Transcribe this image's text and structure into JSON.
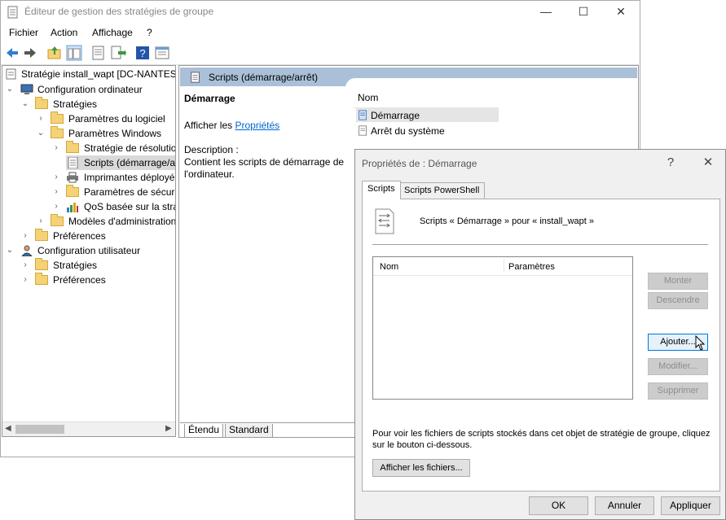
{
  "window": {
    "title": "Éditeur de gestion des stratégies de groupe",
    "minimize": "—",
    "maximize": "☐",
    "close": "✕"
  },
  "menu": {
    "file": "Fichier",
    "action": "Action",
    "view": "Affichage",
    "help": "?"
  },
  "tree": {
    "root": "Stratégie install_wapt [DC-NANTES.",
    "computer_config": "Configuration ordinateur",
    "strategies": "Stratégies",
    "software_settings": "Paramètres du logiciel",
    "windows_settings": "Paramètres Windows",
    "name_resolution": "Stratégie de résolutio",
    "scripts": "Scripts (démarrage/ar",
    "printers": "Imprimantes déployé",
    "security": "Paramètres de sécurit",
    "qos": "QoS basée sur la strat",
    "admin_templates": "Modèles d'administration",
    "preferences": "Préférences",
    "user_config": "Configuration utilisateur",
    "user_strategies": "Stratégies",
    "user_preferences": "Préférences"
  },
  "pane": {
    "header": "Scripts (démarrage/arrêt)",
    "selected_title": "Démarrage",
    "show_prefix": "Afficher les ",
    "show_link": "Propriétés",
    "description_label": "Description :",
    "description_text_1": "Contient les scripts de démarrage de",
    "description_text_2": "l'ordinateur.",
    "col_name": "Nom",
    "items": [
      "Démarrage",
      "Arrêt du système"
    ]
  },
  "view_tabs": {
    "extended": "Étendu",
    "standard": "Standard"
  },
  "dialog": {
    "title": "Propriétés de : Démarrage",
    "help": "?",
    "close": "✕",
    "tabs": [
      "Scripts",
      "Scripts PowerShell"
    ],
    "heading": "Scripts « Démarrage » pour « install_wapt »",
    "list_columns": [
      "Nom",
      "Paramètres"
    ],
    "buttons": {
      "up": "Monter",
      "down": "Descendre",
      "add": "Ajouter...",
      "edit": "Modifier...",
      "remove": "Supprimer"
    },
    "info_1": "Pour voir les fichiers de scripts stockés dans cet objet de stratégie de groupe, cliquez",
    "info_2": "sur le bouton ci-dessous.",
    "show_files": "Afficher les fichiers...",
    "ok": "OK",
    "cancel": "Annuler",
    "apply": "Appliquer"
  }
}
